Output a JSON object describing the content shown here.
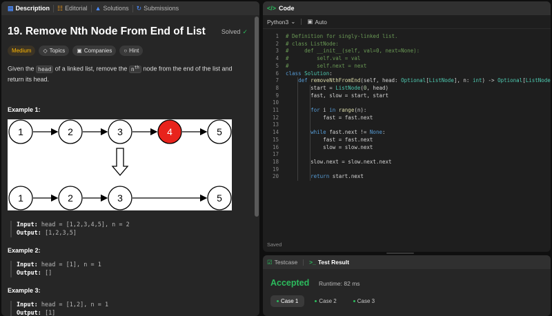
{
  "left_tabs": [
    {
      "label": "Description",
      "icon": "document-icon",
      "active": true
    },
    {
      "label": "Editorial",
      "icon": "book-icon",
      "active": false
    },
    {
      "label": "Solutions",
      "icon": "flask-icon",
      "active": false
    },
    {
      "label": "Submissions",
      "icon": "history-icon",
      "active": false
    }
  ],
  "problem": {
    "title": "19. Remove Nth Node From End of List",
    "status": "Solved",
    "difficulty": "Medium",
    "tags": [
      "Topics",
      "Companies",
      "Hint"
    ],
    "desc_1": "Given the ",
    "desc_code1": "head",
    "desc_2": " of a linked list, remove the ",
    "desc_code2": "n",
    "desc_sup": "th",
    "desc_3": " node from the end of the list and return its head."
  },
  "examples": [
    {
      "title": "Example 1:",
      "input_label": "Input:",
      "input": " head = [1,2,3,4,5], n = 2",
      "output_label": "Output:",
      "output": " [1,2,3,5]"
    },
    {
      "title": "Example 2:",
      "input_label": "Input:",
      "input": " head = [1], n = 1",
      "output_label": "Output:",
      "output": " []"
    },
    {
      "title": "Example 3:",
      "input_label": "Input:",
      "input": " head = [1,2], n = 1",
      "output_label": "Output:",
      "output": " [1]"
    }
  ],
  "diagram": {
    "top_nodes": [
      "1",
      "2",
      "3",
      "4",
      "5"
    ],
    "removed_node": "4",
    "bottom_nodes": [
      "1",
      "2",
      "3",
      "5"
    ],
    "highlight_color": "#e8231c"
  },
  "code_panel": {
    "title": "Code",
    "language": "Python3",
    "mode": "Auto",
    "status": "Saved"
  },
  "code_lines": [
    "# Definition for singly-linked list.",
    "# class ListNode:",
    "#     def __init__(self, val=0, next=None):",
    "#         self.val = val",
    "#         self.next = next",
    "class Solution:",
    "    def removeNthFromEnd(self, head: Optional[ListNode], n: int) -> Optional[ListNode]:",
    "        start = ListNode(0, head)",
    "        fast, slow = start, start",
    "",
    "        for i in range(n):",
    "            fast = fast.next",
    "",
    "        while fast.next != None:",
    "            fast = fast.next",
    "            slow = slow.next",
    "",
    "        slow.next = slow.next.next",
    "",
    "        return start.next"
  ],
  "result_panel": {
    "tab_testcase": "Testcase",
    "tab_result": "Test Result",
    "verdict": "Accepted",
    "runtime": "Runtime: 82 ms",
    "cases": [
      "Case 1",
      "Case 2",
      "Case 3"
    ]
  },
  "colors": {
    "accent_green": "#2cbb5d",
    "medium": "#ffb800",
    "link_blue": "#4c8dff"
  }
}
